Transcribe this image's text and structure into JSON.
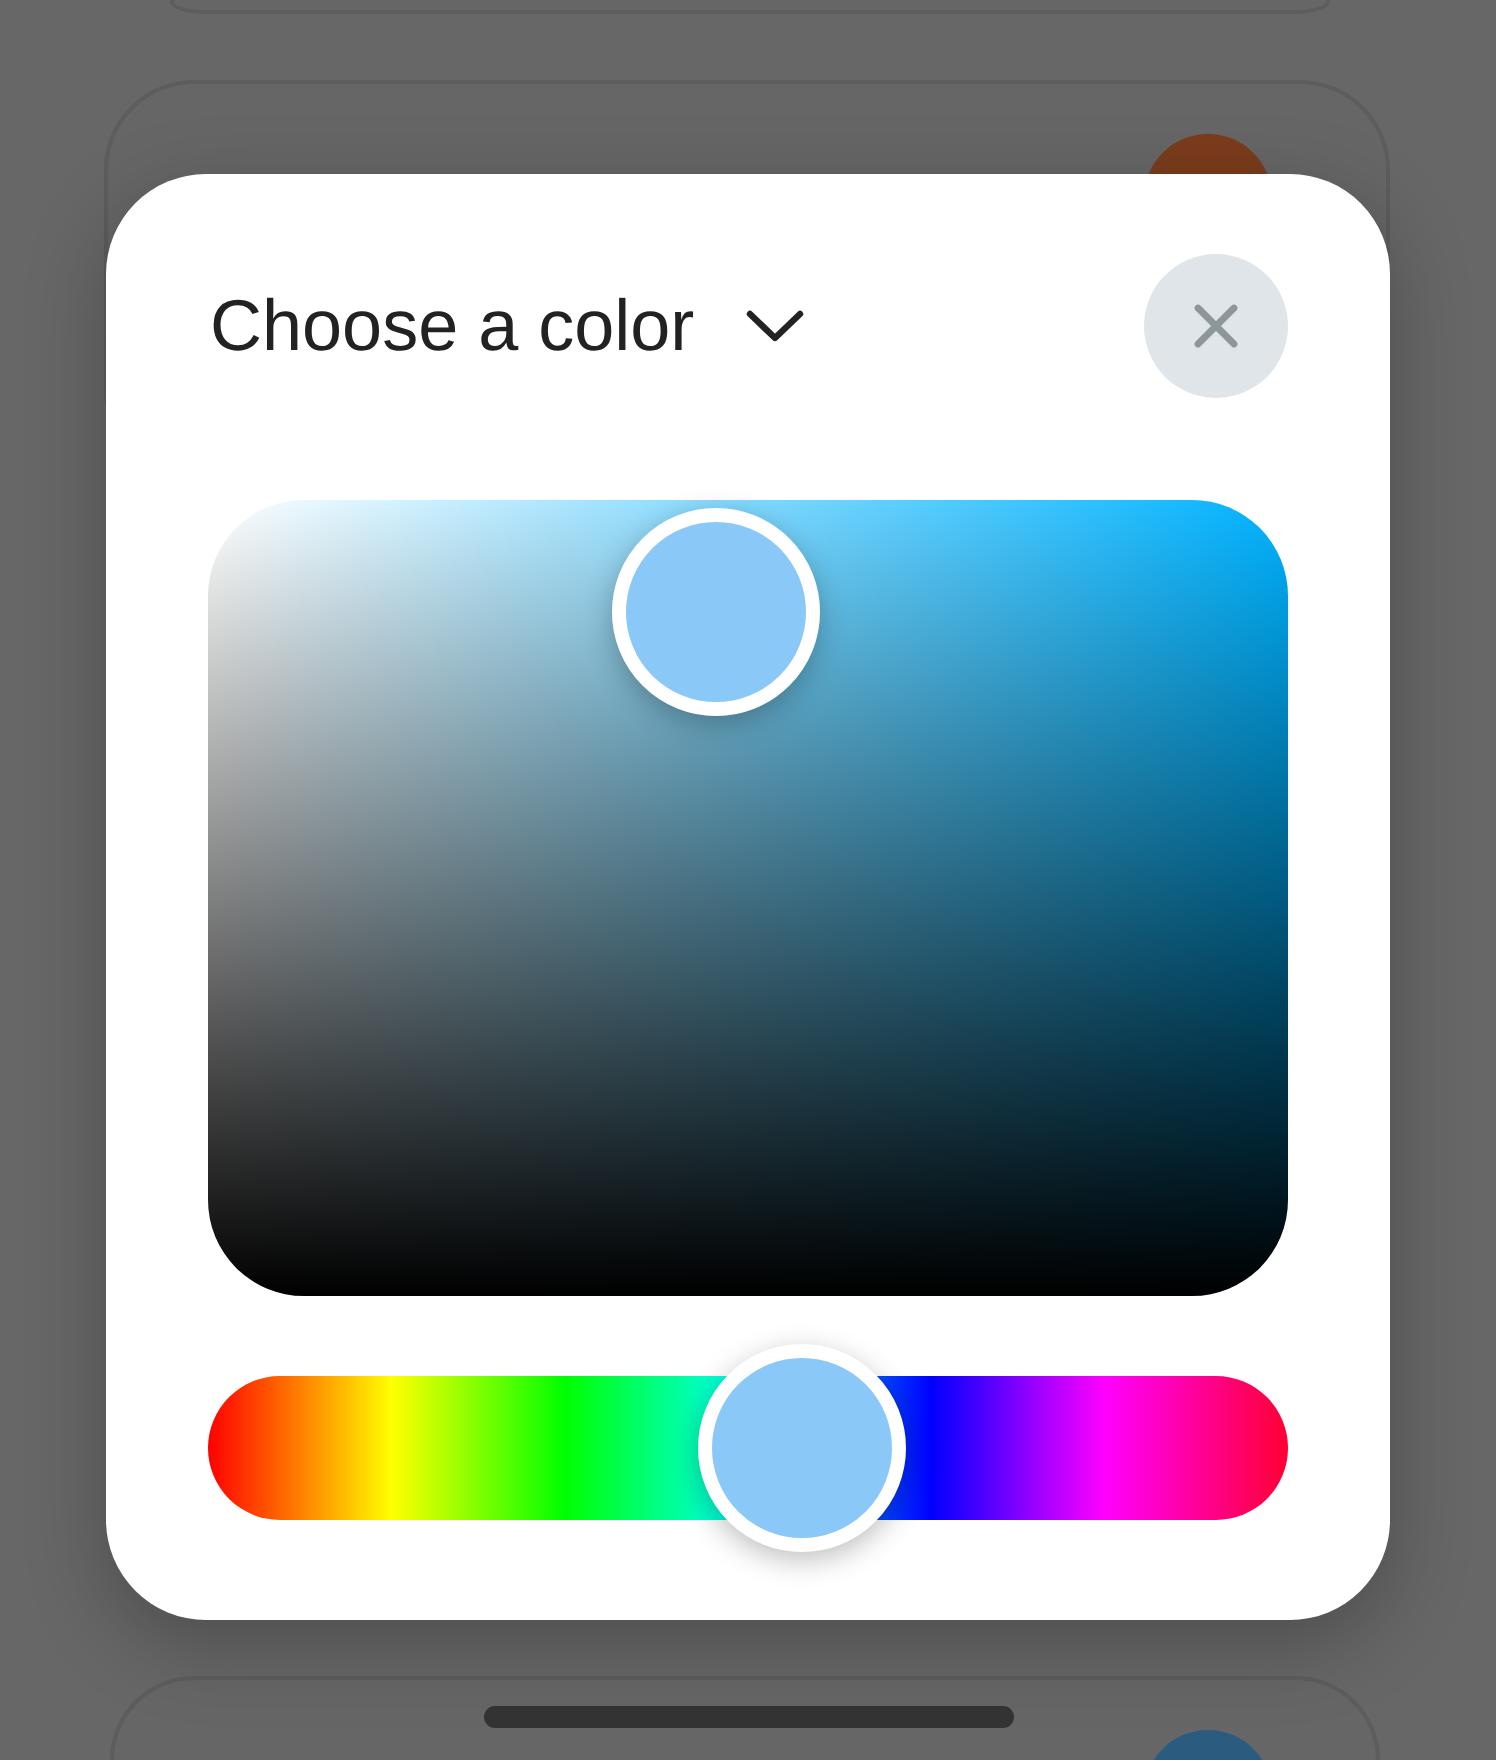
{
  "background_cards": [
    {
      "kind": "plain"
    },
    {
      "kind": "swatch",
      "color": "#7b3c1c"
    },
    {
      "kind": "swatch",
      "color": "#2c5b80"
    }
  ],
  "color_picker": {
    "title": "Choose a color",
    "color": "#8ac8f8",
    "field": {
      "saturation": {
        "level": 0.47
      },
      "brightness": {
        "level": 0.86
      }
    },
    "hue": {
      "level": 0.55
    }
  }
}
